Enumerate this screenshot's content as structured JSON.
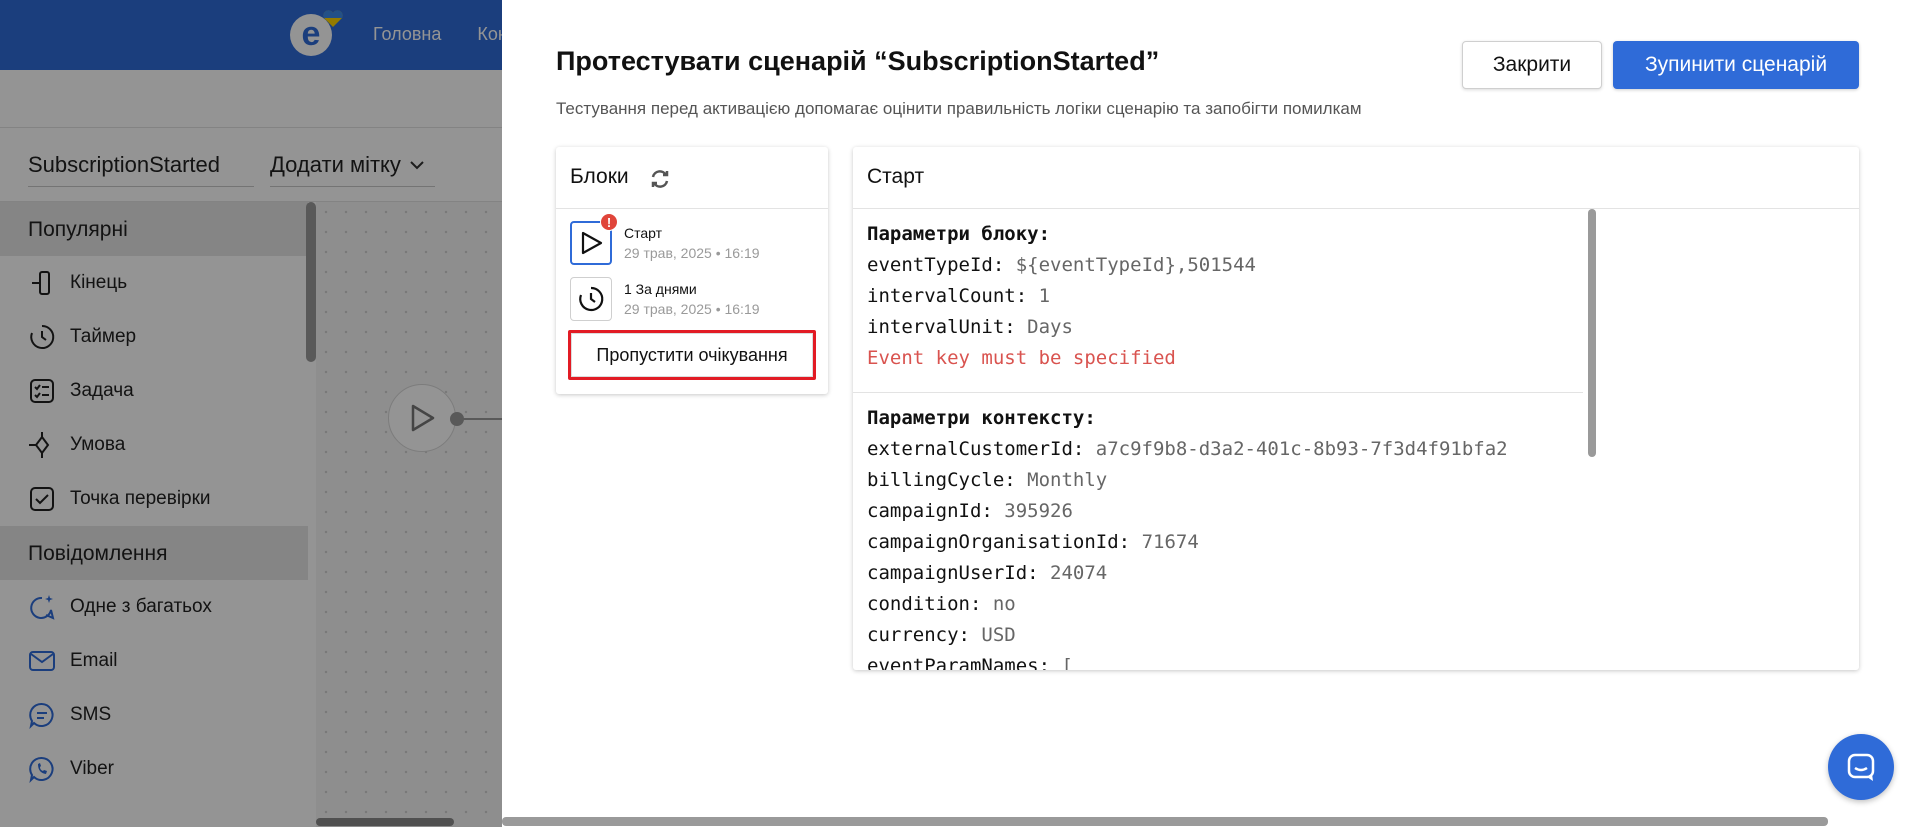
{
  "app": {
    "nav": [
      "Головна",
      "Кон"
    ],
    "scenario_name": "SubscriptionStarted",
    "add_tag_label": "Додати мітку"
  },
  "sidebar": {
    "sections": [
      {
        "title": "Популярні",
        "items": [
          {
            "label": "Кінець",
            "icon": "end-icon"
          },
          {
            "label": "Таймер",
            "icon": "timer-icon"
          },
          {
            "label": "Задача",
            "icon": "task-icon"
          },
          {
            "label": "Умова",
            "icon": "condition-icon"
          },
          {
            "label": "Точка перевірки",
            "icon": "checkpoint-icon"
          }
        ]
      },
      {
        "title": "Повідомлення",
        "items": [
          {
            "label": "Одне з багатьох",
            "icon": "sparkle-chat-icon"
          },
          {
            "label": "Email",
            "icon": "mail-icon"
          },
          {
            "label": "SMS",
            "icon": "chat-bubble-icon"
          },
          {
            "label": "Viber",
            "icon": "viber-icon"
          }
        ]
      }
    ]
  },
  "modal": {
    "title": "Протестувати сценарій “SubscriptionStarted”",
    "subtitle": "Тестування перед активацією допомагає оцінити правильність логіки сценарію та запобігти помилкам",
    "close_label": "Закрити",
    "stop_label": "Зупинити сценарій",
    "blocks": {
      "title": "Блоки",
      "items": [
        {
          "name": "Старт",
          "date": "29 трав, 2025 • 16:19",
          "icon": "play-icon",
          "has_error": true
        },
        {
          "name": "1 За днями",
          "date": "29 трав, 2025 • 16:19",
          "icon": "timer-icon",
          "has_error": false
        }
      ],
      "skip_label": "Пропустити очікування",
      "error_badge": "!"
    },
    "details": {
      "title": "Старт",
      "block_params_title": "Параметри блоку:",
      "block_params": [
        {
          "key": "eventTypeId:",
          "value": "${eventTypeId},501544"
        },
        {
          "key": "intervalCount:",
          "value": "1"
        },
        {
          "key": "intervalUnit:",
          "value": "Days"
        }
      ],
      "block_error": "Event key must be specified",
      "context_params_title": "Параметри контексту:",
      "context_params": [
        {
          "key": "externalCustomerId:",
          "value": "a7c9f9b8-d3a2-401c-8b93-7f3d4f91bfa2"
        },
        {
          "key": "billingCycle:",
          "value": "Monthly"
        },
        {
          "key": "campaignId:",
          "value": "395926"
        },
        {
          "key": "campaignOrganisationId:",
          "value": "71674"
        },
        {
          "key": "campaignUserId:",
          "value": "24074"
        },
        {
          "key": "condition:",
          "value": "no"
        },
        {
          "key": "currency:",
          "value": "USD"
        },
        {
          "key": "eventParamNames:",
          "value": "["
        }
      ]
    }
  },
  "colors": {
    "brand": "#2f6bd8",
    "error": "#e0453a",
    "highlight": "#e21b24"
  }
}
